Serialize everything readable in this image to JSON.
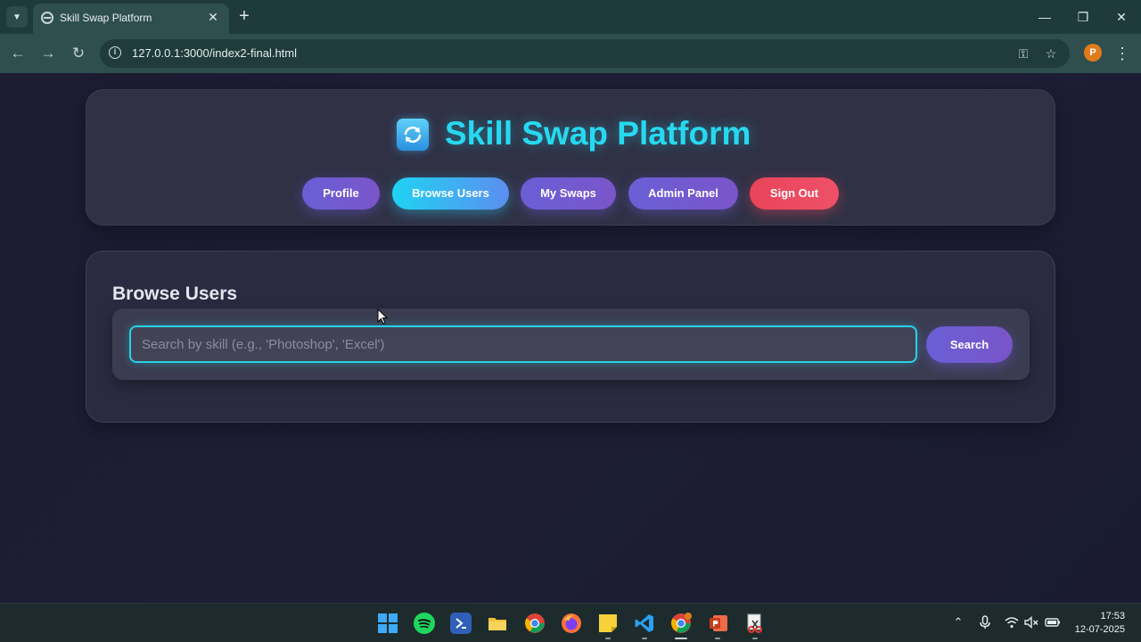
{
  "browser": {
    "tab_title": "Skill Swap Platform",
    "url": "127.0.0.1:3000/index2-final.html",
    "profile_initial": "P"
  },
  "header": {
    "title": "Skill Swap Platform",
    "logo_icon": "refresh-arrows-icon",
    "nav": [
      {
        "label": "Profile",
        "active": false
      },
      {
        "label": "Browse Users",
        "active": true
      },
      {
        "label": "My Swaps",
        "active": false
      },
      {
        "label": "Admin Panel",
        "active": false
      },
      {
        "label": "Sign Out",
        "active": false
      }
    ]
  },
  "browse": {
    "title": "Browse Users",
    "search_placeholder": "Search by skill (e.g., 'Photoshop', 'Excel')",
    "search_value": "",
    "search_button": "Search"
  },
  "taskbar": {
    "apps": [
      "windows-start-icon",
      "spotify-icon",
      "powershell-icon",
      "file-explorer-icon",
      "chrome-icon",
      "firefox-icon",
      "sticky-notes-icon",
      "vscode-icon",
      "chrome-profile-icon",
      "powerpoint-icon",
      "snipping-tool-icon"
    ],
    "time": "17:53",
    "date": "12-07-2025"
  },
  "colors": {
    "accent_cyan": "#27d9f0",
    "pill_purple": "#6a5fd6",
    "pill_red": "#e9445a",
    "background": "#1c1c33"
  }
}
